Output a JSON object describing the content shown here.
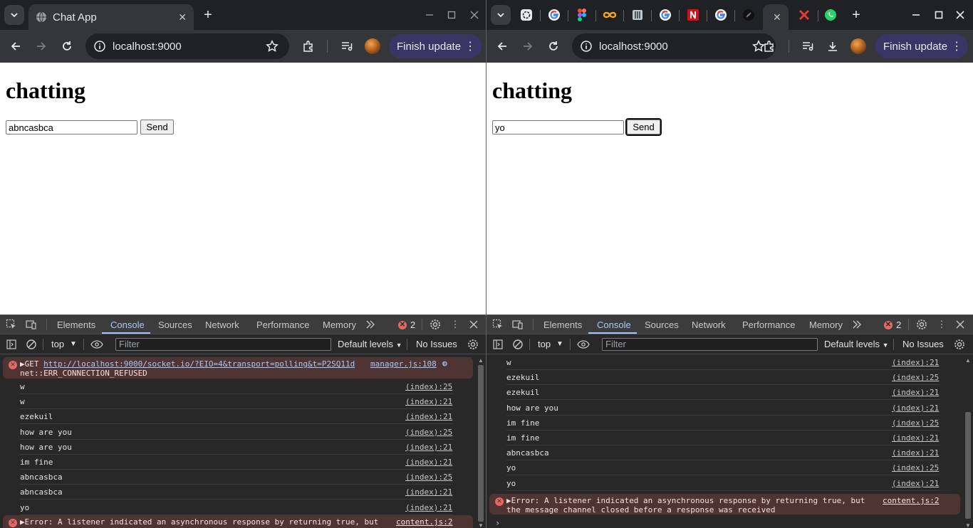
{
  "left": {
    "tab_title": "Chat App",
    "url": "localhost:9000",
    "finish_update": "Finish update",
    "page_heading": "chatting",
    "input_value": "abncasbca",
    "send_label": "Send",
    "devtools": {
      "tabs": [
        "Elements",
        "Console",
        "Sources",
        "Network",
        "Performance",
        "Memory"
      ],
      "error_count": "2",
      "context": "top",
      "filter_placeholder": "Filter",
      "levels": "Default levels",
      "issues": "No Issues",
      "error1": {
        "prefix": "GET ",
        "url": "http://localhost:9000/socket.io/?EIO=4&transport=polling&t=P2SQ11d",
        "line2": "net::ERR_CONNECTION_REFUSED",
        "source": "manager.js:108"
      },
      "logs": [
        {
          "msg": "w",
          "src": "(index):25"
        },
        {
          "msg": "w",
          "src": "(index):21"
        },
        {
          "msg": "ezekuil",
          "src": "(index):21"
        },
        {
          "msg": "how are you",
          "src": "(index):25"
        },
        {
          "msg": "how are you",
          "src": "(index):21"
        },
        {
          "msg": "im fine",
          "src": "(index):21"
        },
        {
          "msg": "abncasbca",
          "src": "(index):25"
        },
        {
          "msg": "abncasbca",
          "src": "(index):21"
        },
        {
          "msg": "yo",
          "src": "(index):21"
        }
      ],
      "error2": {
        "text": "Error: A listener indicated an asynchronous response by returning true, but",
        "source": "content.js:2"
      }
    }
  },
  "right": {
    "url": "localhost:9000",
    "finish_update": "Finish update",
    "page_heading": "chatting",
    "input_value": "yo",
    "send_label": "Send",
    "devtools": {
      "tabs": [
        "Elements",
        "Console",
        "Sources",
        "Network",
        "Performance",
        "Memory"
      ],
      "error_count": "2",
      "context": "top",
      "filter_placeholder": "Filter",
      "levels": "Default levels",
      "issues": "No Issues",
      "logs": [
        {
          "msg": "w",
          "src": "(index):21"
        },
        {
          "msg": "ezekuil",
          "src": "(index):25"
        },
        {
          "msg": "ezekuil",
          "src": "(index):21"
        },
        {
          "msg": "how are you",
          "src": "(index):21"
        },
        {
          "msg": "im fine",
          "src": "(index):25"
        },
        {
          "msg": "im fine",
          "src": "(index):21"
        },
        {
          "msg": "abncasbca",
          "src": "(index):21"
        },
        {
          "msg": "yo",
          "src": "(index):25"
        },
        {
          "msg": "yo",
          "src": "(index):21"
        }
      ],
      "error": {
        "line1": "Error: A listener indicated an asynchronous response by returning true, but",
        "line2": "the message channel closed before a response was received",
        "source": "content.js:2"
      }
    }
  },
  "colors": {
    "finish_update_bg": "#3b3566",
    "console_active": "#a8c7fa",
    "error_bg": "#4e3534",
    "error_icon": "#e46962"
  }
}
